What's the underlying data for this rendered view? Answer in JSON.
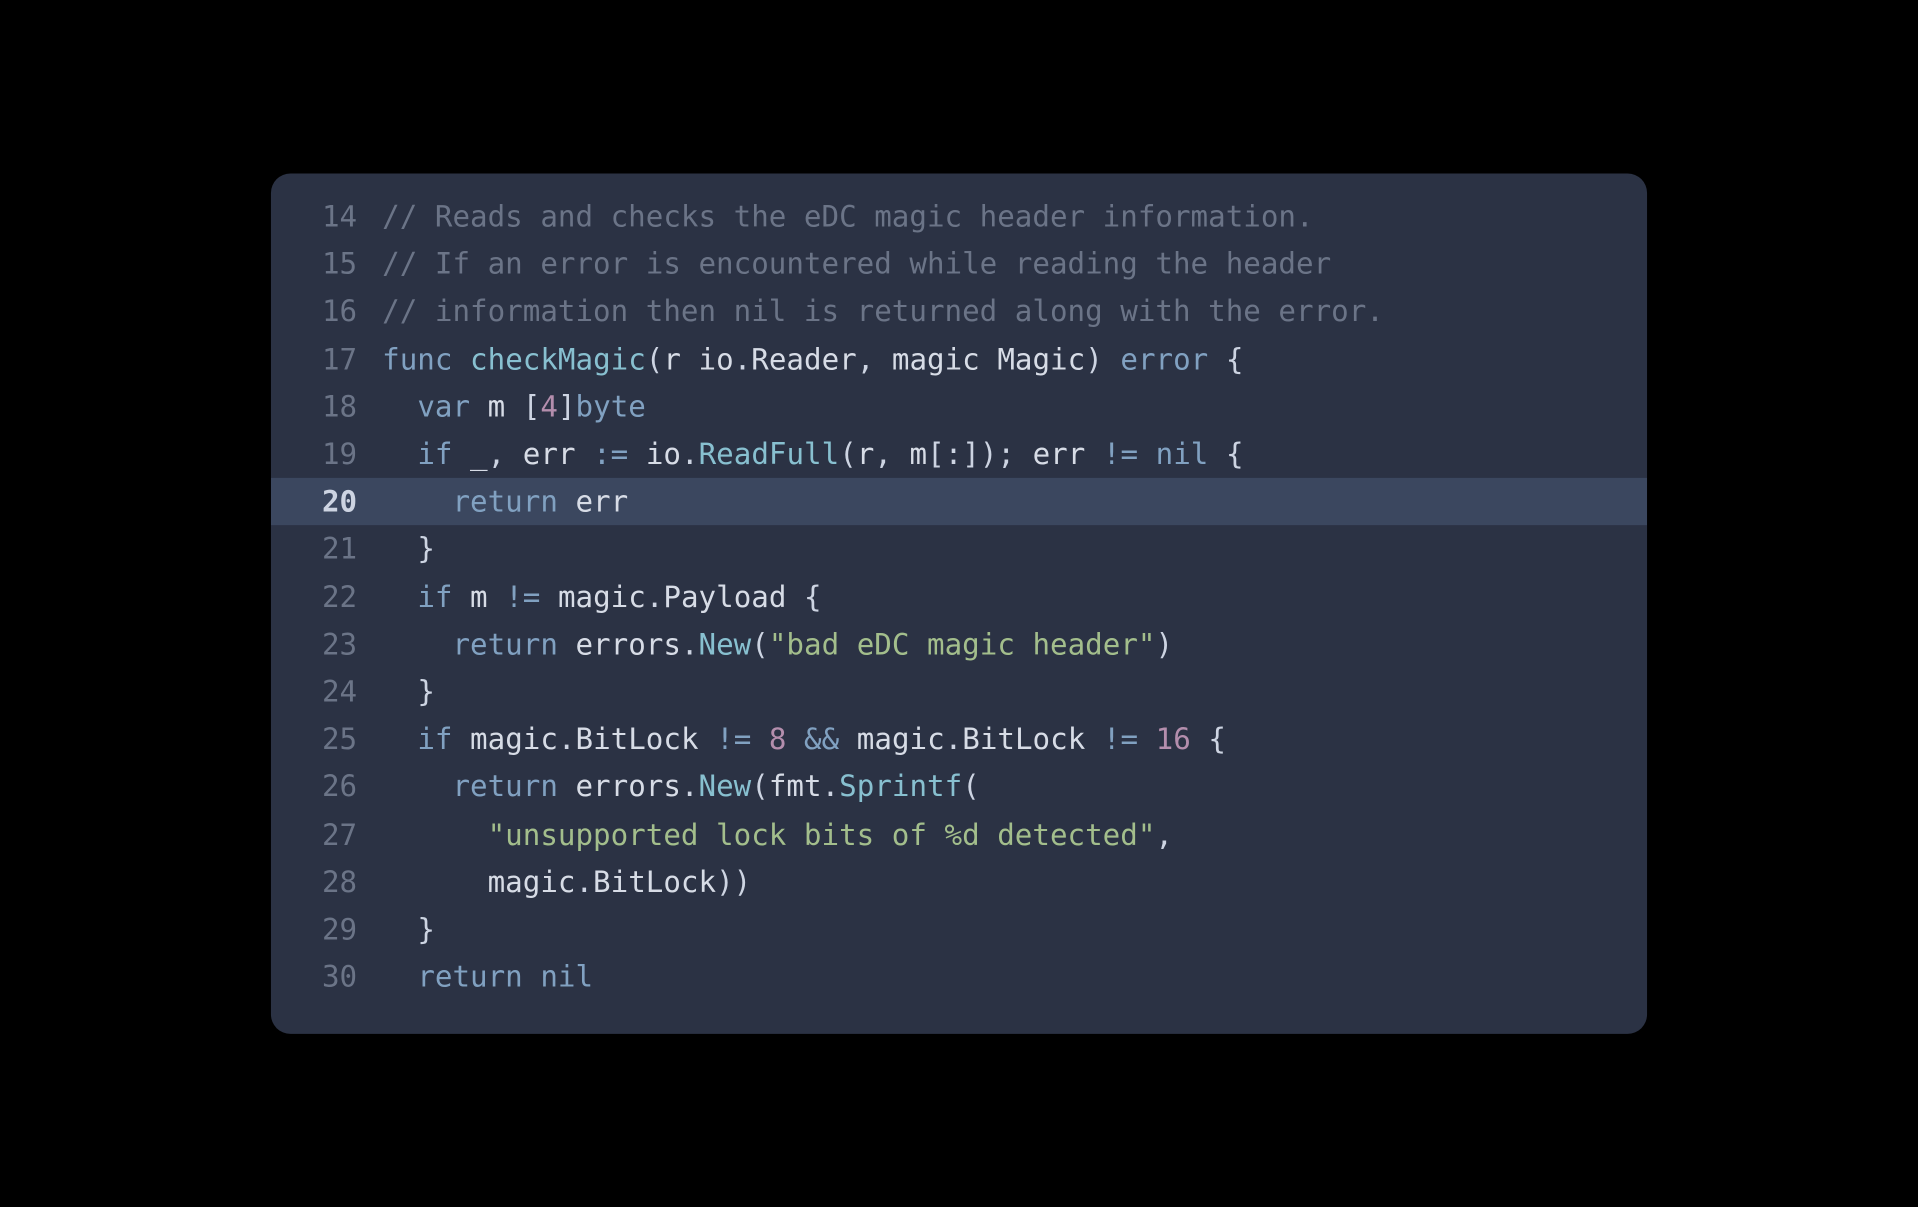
{
  "highlighted_line": 20,
  "lines": [
    {
      "n": 14,
      "tokens": [
        {
          "cls": "c",
          "t": "// Reads and checks the eDC magic header information."
        }
      ]
    },
    {
      "n": 15,
      "tokens": [
        {
          "cls": "c",
          "t": "// If an error is encountered while reading the header"
        }
      ]
    },
    {
      "n": 16,
      "tokens": [
        {
          "cls": "c",
          "t": "// information then nil is returned along with the error."
        }
      ]
    },
    {
      "n": 17,
      "tokens": [
        {
          "cls": "kw",
          "t": "func"
        },
        {
          "cls": "id",
          "t": " "
        },
        {
          "cls": "fn",
          "t": "checkMagic"
        },
        {
          "cls": "pu",
          "t": "("
        },
        {
          "cls": "id",
          "t": "r io"
        },
        {
          "cls": "pu",
          "t": "."
        },
        {
          "cls": "id",
          "t": "Reader"
        },
        {
          "cls": "pu",
          "t": ", "
        },
        {
          "cls": "id",
          "t": "magic Magic"
        },
        {
          "cls": "pu",
          "t": ") "
        },
        {
          "cls": "ty",
          "t": "error"
        },
        {
          "cls": "pu",
          "t": " {"
        }
      ]
    },
    {
      "n": 18,
      "tokens": [
        {
          "cls": "id",
          "t": "  "
        },
        {
          "cls": "kw",
          "t": "var"
        },
        {
          "cls": "id",
          "t": " m "
        },
        {
          "cls": "pu",
          "t": "["
        },
        {
          "cls": "nm",
          "t": "4"
        },
        {
          "cls": "pu",
          "t": "]"
        },
        {
          "cls": "ty",
          "t": "byte"
        }
      ]
    },
    {
      "n": 19,
      "tokens": [
        {
          "cls": "id",
          "t": "  "
        },
        {
          "cls": "kw",
          "t": "if"
        },
        {
          "cls": "id",
          "t": " _"
        },
        {
          "cls": "pu",
          "t": ", "
        },
        {
          "cls": "id",
          "t": "err "
        },
        {
          "cls": "op",
          "t": ":="
        },
        {
          "cls": "id",
          "t": " io"
        },
        {
          "cls": "pu",
          "t": "."
        },
        {
          "cls": "fn",
          "t": "ReadFull"
        },
        {
          "cls": "pu",
          "t": "("
        },
        {
          "cls": "id",
          "t": "r"
        },
        {
          "cls": "pu",
          "t": ", "
        },
        {
          "cls": "id",
          "t": "m"
        },
        {
          "cls": "pu",
          "t": "[:]); "
        },
        {
          "cls": "id",
          "t": "err "
        },
        {
          "cls": "op",
          "t": "!="
        },
        {
          "cls": "id",
          "t": " "
        },
        {
          "cls": "kc",
          "t": "nil"
        },
        {
          "cls": "pu",
          "t": " {"
        }
      ]
    },
    {
      "n": 20,
      "tokens": [
        {
          "cls": "id",
          "t": "    "
        },
        {
          "cls": "kw",
          "t": "return"
        },
        {
          "cls": "id",
          "t": " err"
        }
      ]
    },
    {
      "n": 21,
      "tokens": [
        {
          "cls": "id",
          "t": "  "
        },
        {
          "cls": "pu",
          "t": "}"
        }
      ]
    },
    {
      "n": 22,
      "tokens": [
        {
          "cls": "id",
          "t": "  "
        },
        {
          "cls": "kw",
          "t": "if"
        },
        {
          "cls": "id",
          "t": " m "
        },
        {
          "cls": "op",
          "t": "!="
        },
        {
          "cls": "id",
          "t": " magic"
        },
        {
          "cls": "pu",
          "t": "."
        },
        {
          "cls": "id",
          "t": "Payload "
        },
        {
          "cls": "pu",
          "t": "{"
        }
      ]
    },
    {
      "n": 23,
      "tokens": [
        {
          "cls": "id",
          "t": "    "
        },
        {
          "cls": "kw",
          "t": "return"
        },
        {
          "cls": "id",
          "t": " errors"
        },
        {
          "cls": "pu",
          "t": "."
        },
        {
          "cls": "fn",
          "t": "New"
        },
        {
          "cls": "pu",
          "t": "("
        },
        {
          "cls": "st",
          "t": "\"bad eDC magic header\""
        },
        {
          "cls": "pu",
          "t": ")"
        }
      ]
    },
    {
      "n": 24,
      "tokens": [
        {
          "cls": "id",
          "t": "  "
        },
        {
          "cls": "pu",
          "t": "}"
        }
      ]
    },
    {
      "n": 25,
      "tokens": [
        {
          "cls": "id",
          "t": "  "
        },
        {
          "cls": "kw",
          "t": "if"
        },
        {
          "cls": "id",
          "t": " magic"
        },
        {
          "cls": "pu",
          "t": "."
        },
        {
          "cls": "id",
          "t": "BitLock "
        },
        {
          "cls": "op",
          "t": "!="
        },
        {
          "cls": "id",
          "t": " "
        },
        {
          "cls": "nm",
          "t": "8"
        },
        {
          "cls": "id",
          "t": " "
        },
        {
          "cls": "op",
          "t": "&&"
        },
        {
          "cls": "id",
          "t": " magic"
        },
        {
          "cls": "pu",
          "t": "."
        },
        {
          "cls": "id",
          "t": "BitLock "
        },
        {
          "cls": "op",
          "t": "!="
        },
        {
          "cls": "id",
          "t": " "
        },
        {
          "cls": "nm",
          "t": "16"
        },
        {
          "cls": "pu",
          "t": " {"
        }
      ]
    },
    {
      "n": 26,
      "tokens": [
        {
          "cls": "id",
          "t": "    "
        },
        {
          "cls": "kw",
          "t": "return"
        },
        {
          "cls": "id",
          "t": " errors"
        },
        {
          "cls": "pu",
          "t": "."
        },
        {
          "cls": "fn",
          "t": "New"
        },
        {
          "cls": "pu",
          "t": "("
        },
        {
          "cls": "id",
          "t": "fmt"
        },
        {
          "cls": "pu",
          "t": "."
        },
        {
          "cls": "fn",
          "t": "Sprintf"
        },
        {
          "cls": "pu",
          "t": "("
        }
      ]
    },
    {
      "n": 27,
      "tokens": [
        {
          "cls": "id",
          "t": "      "
        },
        {
          "cls": "st",
          "t": "\"unsupported lock bits of %d detected\""
        },
        {
          "cls": "pu",
          "t": ","
        }
      ]
    },
    {
      "n": 28,
      "tokens": [
        {
          "cls": "id",
          "t": "      magic"
        },
        {
          "cls": "pu",
          "t": "."
        },
        {
          "cls": "id",
          "t": "BitLock"
        },
        {
          "cls": "pu",
          "t": "))"
        }
      ]
    },
    {
      "n": 29,
      "tokens": [
        {
          "cls": "id",
          "t": "  "
        },
        {
          "cls": "pu",
          "t": "}"
        }
      ]
    },
    {
      "n": 30,
      "tokens": [
        {
          "cls": "id",
          "t": "  "
        },
        {
          "cls": "kw",
          "t": "return"
        },
        {
          "cls": "id",
          "t": " "
        },
        {
          "cls": "kc",
          "t": "nil"
        }
      ]
    }
  ]
}
